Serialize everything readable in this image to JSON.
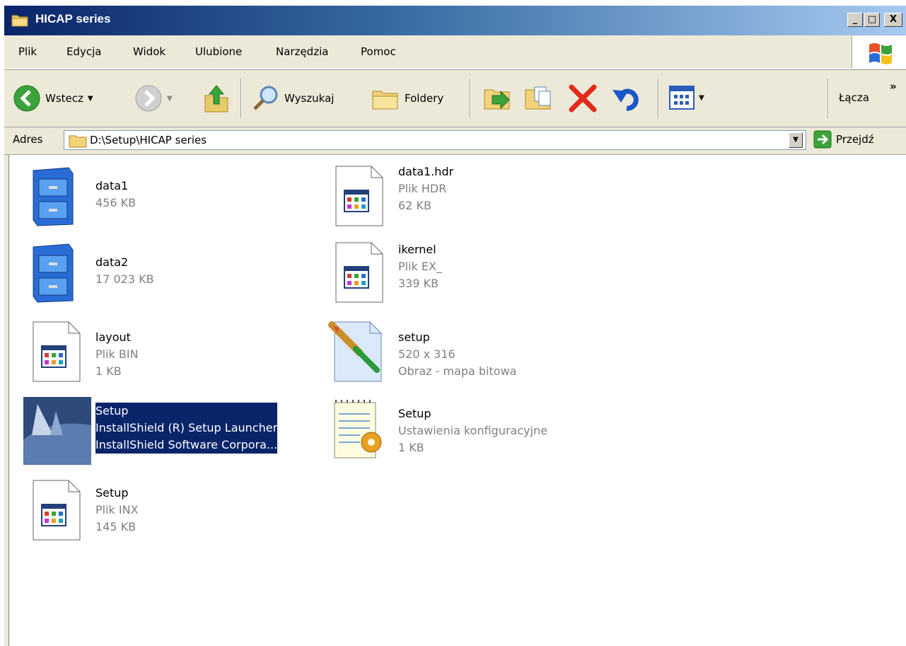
{
  "window": {
    "title": "HICAP series",
    "buttons": {
      "minimize": "_",
      "maximize": "□",
      "close": "X"
    }
  },
  "menu": [
    "Plik",
    "Edycja",
    "Widok",
    "Ulubione",
    "Narzędzia",
    "Pomoc"
  ],
  "toolbar": {
    "back": "Wstecz",
    "search": "Wyszukaj",
    "folders": "Foldery",
    "links": "Łącza",
    "overflow": "»"
  },
  "address": {
    "label": "Adres",
    "path": "D:\\Setup\\HICAP series",
    "go": "Przejdź"
  },
  "files": [
    {
      "name": "data1",
      "line2": "456 KB",
      "line3": "",
      "icon": "cabinet-icon"
    },
    {
      "name": "data1.hdr",
      "line2": "Plik HDR",
      "line3": "62 KB",
      "icon": "generic-file-icon"
    },
    {
      "name": "data2",
      "line2": "17 023 KB",
      "line3": "",
      "icon": "cabinet-icon"
    },
    {
      "name": "ikernel",
      "line2": "Plik EX_",
      "line3": "339 KB",
      "icon": "generic-file-icon"
    },
    {
      "name": "layout",
      "line2": "Plik BIN",
      "line3": "1 KB",
      "icon": "generic-file-icon"
    },
    {
      "name": "setup",
      "line2": "520 x 316",
      "line3": "Obraz - mapa bitowa",
      "icon": "bitmap-icon"
    },
    {
      "name": "Setup",
      "line2": "InstallShield (R) Setup Launcher",
      "line3": "InstallShield Software Corpora...",
      "icon": "installshield-icon",
      "selected": true
    },
    {
      "name": "Setup",
      "line2": "Ustawienia konfiguracyjne",
      "line3": "1 KB",
      "icon": "config-settings-icon"
    },
    {
      "name": "Setup",
      "line2": "Plik INX",
      "line3": "145 KB",
      "icon": "generic-file-icon"
    }
  ]
}
